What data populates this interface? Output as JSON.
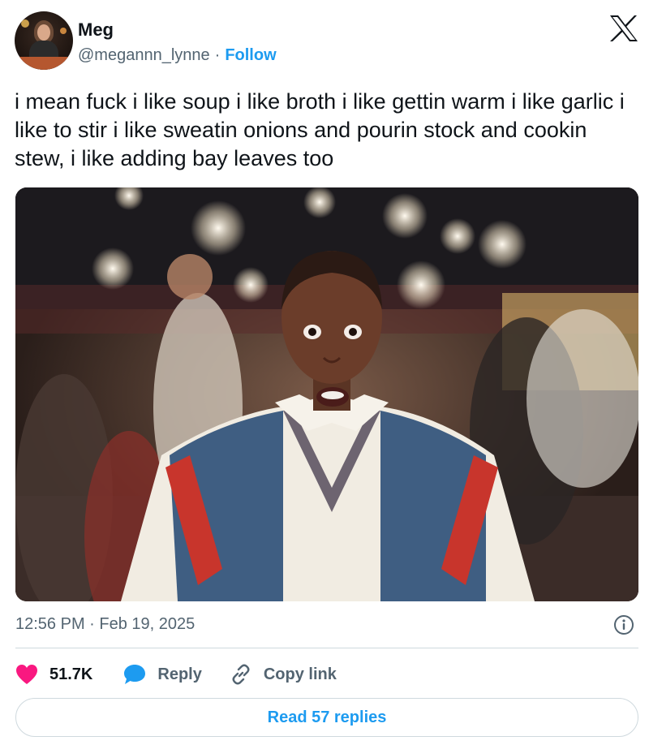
{
  "author": {
    "display_name": "Meg",
    "handle": "@megannn_lynne",
    "separator": "·",
    "follow_label": "Follow"
  },
  "tweet": {
    "text": "i mean fuck i like soup i like broth i like gettin warm i like garlic i like to stir i like sweatin onions and pourin stock and cookin stew, i like adding bay leaves too",
    "timestamp": "12:56 PM · Feb 19, 2025"
  },
  "actions": {
    "like_count": "51.7K",
    "reply_label": "Reply",
    "copy_link_label": "Copy link"
  },
  "read_replies_label": "Read 57 replies",
  "icons": {
    "platform": "x-logo-icon",
    "like": "heart-icon",
    "reply": "speech-bubble-icon",
    "copy": "link-icon",
    "info": "info-icon"
  },
  "colors": {
    "accent": "#1d9bf0",
    "like": "#f91880",
    "text": "#0f1419",
    "secondary": "#536471",
    "border": "#cfd9de"
  }
}
